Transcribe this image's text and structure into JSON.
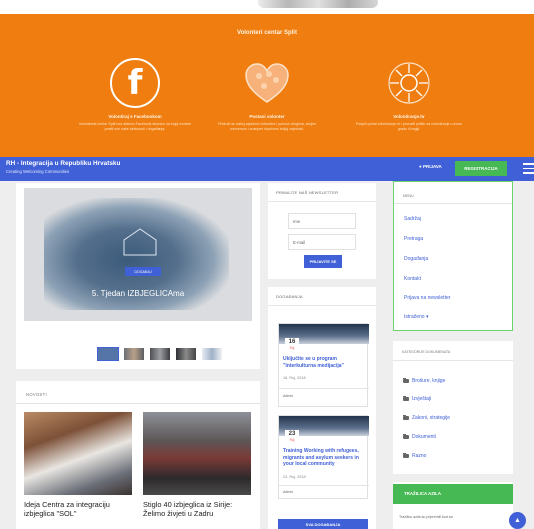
{
  "hero": {
    "title": "Volonteri centar Split",
    "columns": [
      {
        "icon": "facebook-icon",
        "label": "Volontiraj s Facebookom",
        "desc": "Volonterski centar Split ima aktivnu Facebook stranicu na kojoj možete pratiti sve naše aktivnosti i događanja."
      },
      {
        "icon": "heart-icon",
        "label": "Postani volonter",
        "desc": "Pridruži se našoj zajednici volontera i pomozi drugima, svojim vremenom i znanjem doprinosi boljoj zajednici."
      },
      {
        "icon": "sun-icon",
        "label": "Volontiranje.hr",
        "desc": "Posjeti portal volontiranje.hr i pronađi priliku za volontiranje u svom gradu ili regiji."
      }
    ]
  },
  "nav": {
    "brand": "RH - Integracija u Republiku Hrvatsku",
    "tagline": "Creating Welcoming Communities",
    "login": "● PRIJAVA",
    "register": "REGISTRACIJA"
  },
  "slider": {
    "badge": "DOGAĐAJ",
    "caption": "5. Tjedan IZBJEGLICAma"
  },
  "news": {
    "heading": "NOVOSTI",
    "items": [
      {
        "title": "Ideja Centra za integraciju izbjeglica \"SOL\""
      },
      {
        "title": "Stiglo 40 izbjeglica iz Sirije: Želimo živjeti u Zadru"
      }
    ]
  },
  "newsletter": {
    "heading": "PRIMAJTE NAŠ NEWSLETTER",
    "name_placeholder": "Ime",
    "email_placeholder": "E-mail",
    "button": "PRIJAVITE SE"
  },
  "events": {
    "heading": "DOGAĐANJA",
    "items": [
      {
        "day": "16",
        "month": "Ruj",
        "title": "Uključite se u program \"Interkulturna medijacija\"",
        "time": "16. Ruj, 2018",
        "author": "Admin"
      },
      {
        "day": "23",
        "month": "Ruj",
        "title": "Training Working with refugees, migrants and asylum seekers in your local community",
        "time": "23. Ruj, 2018",
        "author": "Admin"
      }
    ],
    "more_button": "SVA DOGAĐANJA"
  },
  "menu": {
    "heading": "MENU",
    "items": [
      "Sadržaj",
      "Pretraga",
      "Događanja",
      "Kontakt",
      "Prijava na newsletter",
      "Istraženo ▾"
    ]
  },
  "categories": {
    "heading": "KATEGORIJE DOKUMENATA",
    "items": [
      "Brošure, knjige",
      "Izvještaji",
      "Zakoni, strategije",
      "Dokumenti",
      "Razno"
    ]
  },
  "search": {
    "heading": "TRAŽILICA AZILA",
    "text": "Tražilicu azila su pripremili kod sa"
  },
  "colors": {
    "orange": "#ef7d0f",
    "blue": "#3f60d6",
    "green": "#46b854"
  }
}
